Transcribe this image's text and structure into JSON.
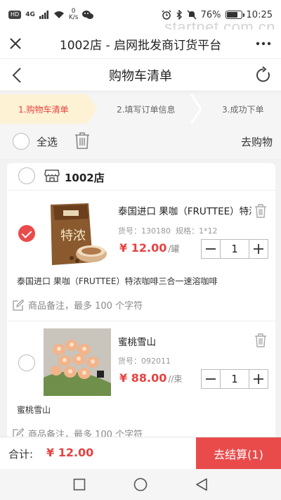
{
  "status_bar": {
    "hd": "HD",
    "network": "4G",
    "speed_value": "0",
    "speed_unit": "K/s",
    "battery": "76%",
    "battery_level": 0.76,
    "time": "10:25",
    "icons": [
      "signal-icon",
      "wifi-icon",
      "wechat-icon",
      "alarm-icon",
      "bluetooth-icon",
      "mute-icon"
    ]
  },
  "watermark": "startnet.com.cn",
  "app_bar": {
    "title": "1002店 - 启网批发商订货平台",
    "close_icon": "close-icon",
    "more_icon": "more-icon"
  },
  "nav_bar": {
    "title": "购物车清单"
  },
  "steps": [
    {
      "label": "1.购物车清单",
      "active": true
    },
    {
      "label": "2.填写订单信息",
      "active": false
    },
    {
      "label": "3.成功下单",
      "active": false
    }
  ],
  "select_bar": {
    "select_all": "全选",
    "go_shopping": "去购物"
  },
  "store": {
    "name": "1002店"
  },
  "items": [
    {
      "checked": true,
      "name": "泰国进口 果咖（FRUTTEE）特浓咖啡三合一速溶咖啡",
      "sku_label": "货号：",
      "sku": "130180",
      "spec_label": "规格：",
      "spec": "1*12",
      "currency": "¥",
      "price": "12.00",
      "unit": "/罐",
      "quantity": "1",
      "description": "泰国进口 果咖（FRUTTEE）特浓咖啡三合一速溶咖啡",
      "remark_placeholder": "商品备注，最多 100 个字符"
    },
    {
      "checked": false,
      "name": "蜜桃雪山",
      "sku_label": "货号：",
      "sku": "092011",
      "currency": "¥",
      "price": "88.00",
      "unit": "//束",
      "quantity": "1",
      "description": "蜜桃雪山",
      "remark_placeholder": "商品备注，最多 100 个字符"
    }
  ],
  "total_bar": {
    "label": "合计:",
    "amount": "¥ 12.00",
    "checkout": "去结算(1)"
  },
  "colors": {
    "accent": "#e94b4b",
    "price": "#e64340",
    "active_step": "#fdf2d4"
  }
}
